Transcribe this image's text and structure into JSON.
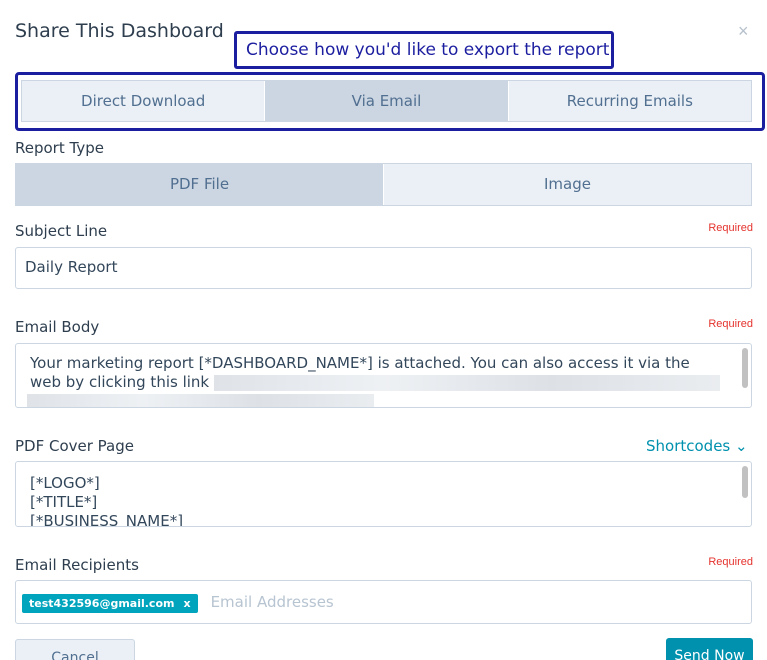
{
  "modal": {
    "title": "Share This Dashboard",
    "close_glyph": "×"
  },
  "callout": {
    "text": "Choose how you'd like to export the report",
    "color": "#1c1ea0"
  },
  "export_tabs": [
    {
      "label": "Direct Download",
      "active": false
    },
    {
      "label": "Via Email",
      "active": true
    },
    {
      "label": "Recurring Emails",
      "active": false
    }
  ],
  "report_type": {
    "label": "Report Type",
    "options": [
      {
        "label": "PDF File",
        "active": true
      },
      {
        "label": "Image",
        "active": false
      }
    ]
  },
  "subject": {
    "label": "Subject Line",
    "required": "Required",
    "value": "Daily Report"
  },
  "email_body": {
    "label": "Email Body",
    "required": "Required",
    "line1": "Your marketing report [*DASHBOARD_NAME*] is attached. You can also access it via the",
    "line2": "web by clicking this link"
  },
  "cover_page": {
    "label": "PDF Cover Page",
    "shortcodes": "Shortcodes",
    "lines": [
      "[*LOGO*]",
      "[*TITLE*]",
      "[*BUSINESS_NAME*]"
    ]
  },
  "recipients": {
    "label": "Email Recipients",
    "required": "Required",
    "chip": "test432596@gmail.com",
    "chip_remove": "x",
    "placeholder": "Email Addresses"
  },
  "footer": {
    "cancel": "Cancel",
    "send": "Send Now"
  },
  "colors": {
    "accent": "#0091ae",
    "chip": "#00a4bd",
    "required": "#e5322d"
  }
}
